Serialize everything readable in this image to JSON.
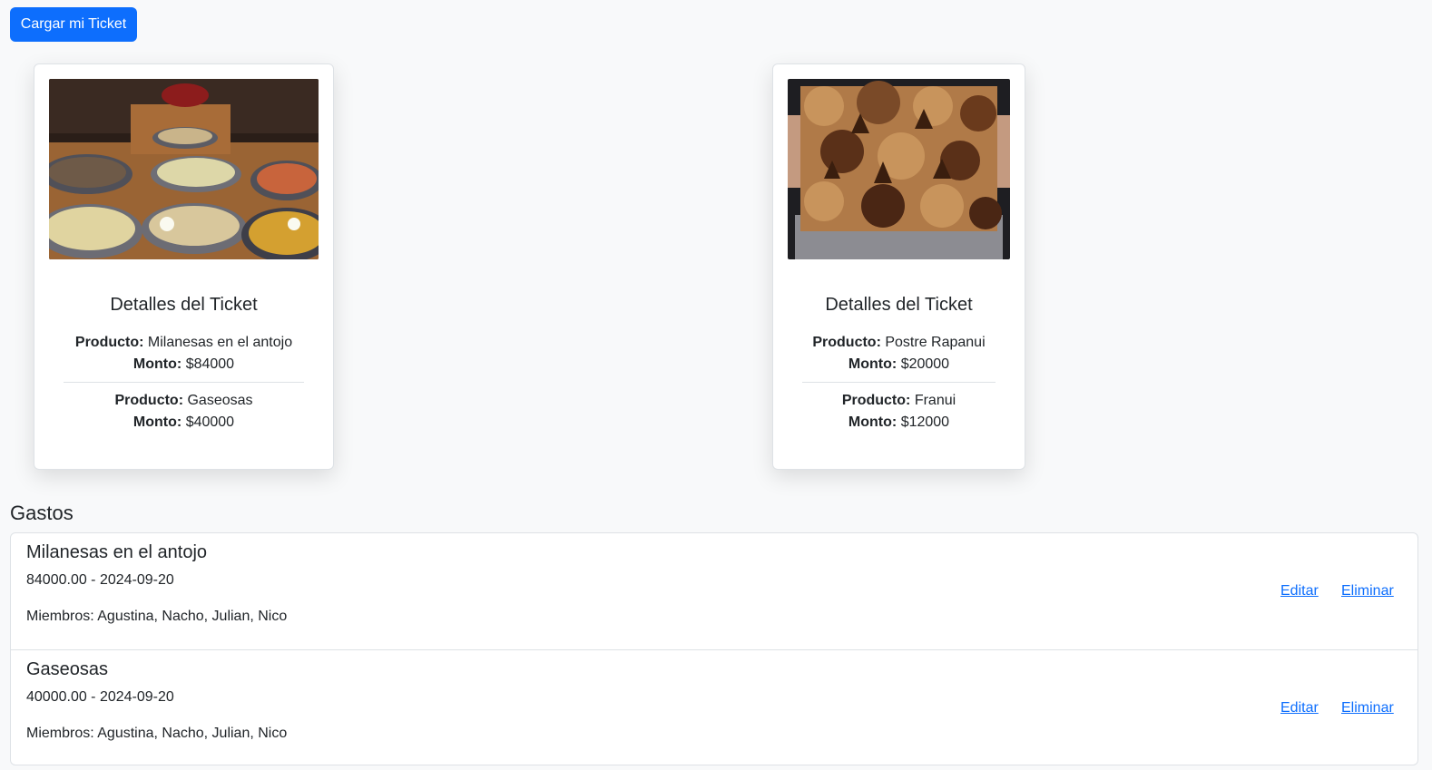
{
  "header": {
    "upload_button": "Cargar mi Ticket"
  },
  "tickets": [
    {
      "photo": "milanesas-photo",
      "title": "Detalles del Ticket",
      "items": [
        {
          "product_label": "Producto:",
          "product": "Milanesas en el antojo",
          "amount_label": "Monto:",
          "amount": "$84000"
        },
        {
          "product_label": "Producto:",
          "product": "Gaseosas",
          "amount_label": "Monto:",
          "amount": "$40000"
        }
      ]
    },
    {
      "photo": "postre-photo",
      "title": "Detalles del Ticket",
      "items": [
        {
          "product_label": "Producto:",
          "product": "Postre Rapanui",
          "amount_label": "Monto:",
          "amount": "$20000"
        },
        {
          "product_label": "Producto:",
          "product": "Franui",
          "amount_label": "Monto:",
          "amount": "$12000"
        }
      ]
    }
  ],
  "gastos": {
    "title": "Gastos",
    "items": [
      {
        "name": "Milanesas en el antojo",
        "amount_date": "84000.00 - 2024-09-20",
        "members": "Miembros: Agustina, Nacho, Julian, Nico",
        "edit": "Editar",
        "delete": "Eliminar"
      },
      {
        "name": "Gaseosas",
        "amount_date": "40000.00 - 2024-09-20",
        "members": "Miembros: Agustina, Nacho, Julian, Nico",
        "edit": "Editar",
        "delete": "Eliminar"
      }
    ]
  },
  "colors": {
    "primary": "#0d6efd",
    "border": "#dee2e6",
    "background": "#f8f9fa"
  }
}
